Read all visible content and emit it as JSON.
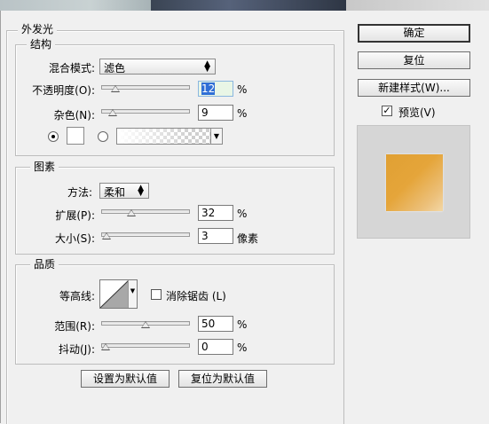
{
  "section_title": "外发光",
  "structure": {
    "title": "结构",
    "blend_mode_label": "混合模式:",
    "blend_mode_value": "滤色",
    "opacity_label": "不透明度(O):",
    "opacity_value": "12",
    "opacity_unit": "%",
    "opacity_fraction": 0.12,
    "noise_label": "杂色(N):",
    "noise_value": "9",
    "noise_unit": "%",
    "noise_fraction": 0.09
  },
  "elements": {
    "title": "图素",
    "technique_label": "方法:",
    "technique_value": "柔和",
    "spread_label": "扩展(P):",
    "spread_value": "32",
    "spread_unit": "%",
    "spread_fraction": 0.32,
    "size_label": "大小(S):",
    "size_value": "3",
    "size_unit": "像素",
    "size_fraction": 0.012
  },
  "quality": {
    "title": "品质",
    "contour_label": "等高线:",
    "antialias_label": "消除锯齿 (L)",
    "antialias_checked": false,
    "range_label": "范围(R):",
    "range_value": "50",
    "range_unit": "%",
    "range_fraction": 0.5,
    "jitter_label": "抖动(J):",
    "jitter_value": "0",
    "jitter_unit": "%",
    "jitter_fraction": 0.0
  },
  "buttons": {
    "set_default": "设置为默认值",
    "reset_default": "复位为默认值",
    "ok": "确定",
    "reset": "复位",
    "new_style": "新建样式(W)...",
    "preview_label": "预览(V)",
    "preview_checked": true
  },
  "colors": {
    "glow_color": "#ffffff",
    "preview_swatch": "#e5a53a",
    "selection": "#2f6fd6"
  },
  "icons": {
    "dropdown": "updown-arrow-icon",
    "check": "checkmark-icon"
  }
}
